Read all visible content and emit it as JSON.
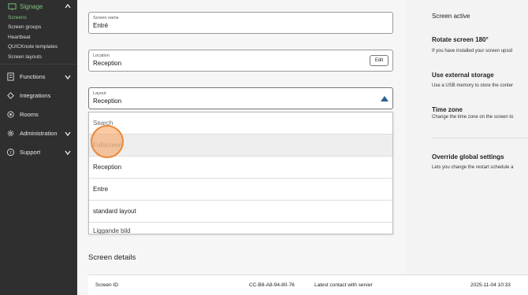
{
  "sidebar": {
    "section": {
      "label": "Signage"
    },
    "subitems": [
      {
        "label": "Screens",
        "active": true
      },
      {
        "label": "Screen groups"
      },
      {
        "label": "Heartbeat"
      },
      {
        "label": "QUICKnote templates"
      },
      {
        "label": "Screen layouts"
      }
    ],
    "items": [
      {
        "label": "Functions",
        "icon": "functions-icon",
        "chevron": true
      },
      {
        "label": "Integrations",
        "icon": "integrations-icon",
        "chevron": false
      },
      {
        "label": "Rooms",
        "icon": "rooms-icon",
        "chevron": false
      },
      {
        "label": "Administration",
        "icon": "gear-icon",
        "chevron": true
      },
      {
        "label": "Support",
        "icon": "help-icon",
        "chevron": true
      }
    ]
  },
  "form": {
    "screen_name": {
      "label": "Screen name",
      "value": "Entré"
    },
    "location": {
      "label": "Location",
      "value": "Reception",
      "edit_label": "Edit"
    },
    "layout": {
      "label": "Layout",
      "value": "Reception"
    }
  },
  "dropdown": {
    "search_placeholder": "Search",
    "options": [
      "Fullscreen",
      "Reception",
      "Entre",
      "standard layout"
    ],
    "partial_option": "Liggande bild"
  },
  "details": {
    "title": "Screen details",
    "screen_id_label": "Screen ID",
    "screen_id_value": "CC-B8-A8-94-80-76",
    "last_contact_label": "Latest contact with server",
    "last_contact_value": "2025-11-04 10:33"
  },
  "right": {
    "screen_active": "Screen active",
    "rotate_title": "Rotate screen 180°",
    "rotate_desc": "If you have installed your screen upsid",
    "storage_title": "Use external storage",
    "storage_desc": "Use a USB memory to store the conter",
    "tz_title": "Time zone",
    "tz_desc": "Change the time zone on the screen to",
    "override_title": "Override global settings",
    "override_desc": "Lets you change the restart schedule a"
  }
}
